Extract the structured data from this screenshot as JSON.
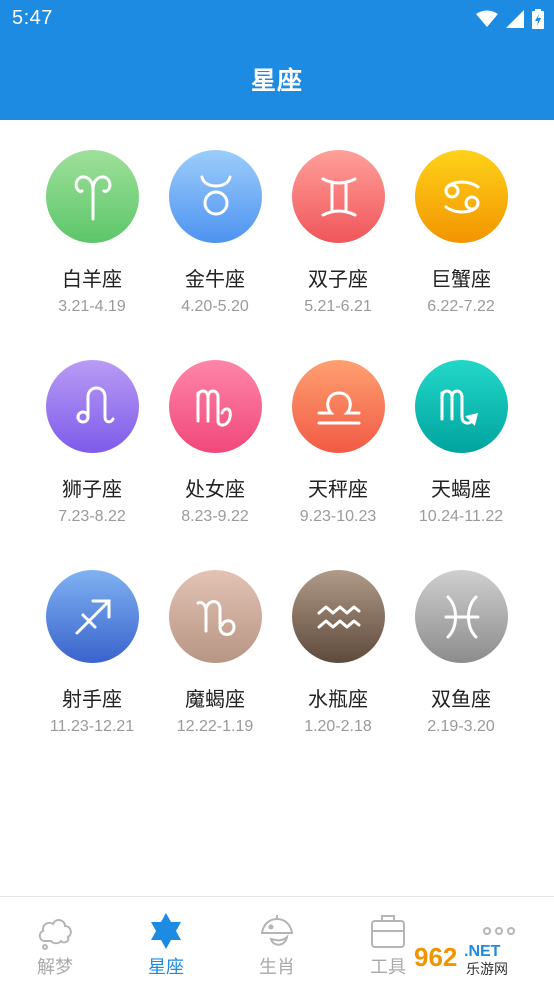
{
  "status_bar": {
    "time": "5:47"
  },
  "header": {
    "title": "星座"
  },
  "zodiacs": [
    {
      "name": "白羊座",
      "date": "3.21-4.19",
      "icon": "aries-icon",
      "colors": [
        "#9fe09a",
        "#5cc66a"
      ]
    },
    {
      "name": "金牛座",
      "date": "4.20-5.20",
      "icon": "taurus-icon",
      "colors": [
        "#9ccdfb",
        "#4e93f0"
      ]
    },
    {
      "name": "双子座",
      "date": "5.21-6.21",
      "icon": "gemini-icon",
      "colors": [
        "#ffa09a",
        "#f0555a"
      ]
    },
    {
      "name": "巨蟹座",
      "date": "6.22-7.22",
      "icon": "cancer-icon",
      "colors": [
        "#ffd21a",
        "#f29400"
      ]
    },
    {
      "name": "狮子座",
      "date": "7.23-8.22",
      "icon": "leo-icon",
      "colors": [
        "#b99cf5",
        "#7e5bea"
      ]
    },
    {
      "name": "处女座",
      "date": "8.23-9.22",
      "icon": "virgo-icon",
      "colors": [
        "#ff86a8",
        "#f0487a"
      ]
    },
    {
      "name": "天秤座",
      "date": "9.23-10.23",
      "icon": "libra-icon",
      "colors": [
        "#ffa070",
        "#f25a45"
      ]
    },
    {
      "name": "天蝎座",
      "date": "10.24-11.22",
      "icon": "scorpio-icon",
      "colors": [
        "#22d8c8",
        "#00a39e"
      ]
    },
    {
      "name": "射手座",
      "date": "11.23-12.21",
      "icon": "sagittarius-icon",
      "colors": [
        "#7fb2f2",
        "#3a63cc"
      ]
    },
    {
      "name": "魔蝎座",
      "date": "12.22-1.19",
      "icon": "capricorn-icon",
      "colors": [
        "#e2c3b4",
        "#b89584"
      ]
    },
    {
      "name": "水瓶座",
      "date": "1.20-2.18",
      "icon": "aquarius-icon",
      "colors": [
        "#b09a88",
        "#5e4a3c"
      ]
    },
    {
      "name": "双鱼座",
      "date": "2.19-3.20",
      "icon": "pisces-icon",
      "colors": [
        "#cfcfcf",
        "#8c8c8c"
      ]
    }
  ],
  "tabs": [
    {
      "label": "解梦",
      "icon": "cloud-icon",
      "active": false
    },
    {
      "label": "星座",
      "icon": "star-icon",
      "active": true
    },
    {
      "label": "生肖",
      "icon": "zodiac-animal-icon",
      "active": false
    },
    {
      "label": "工具",
      "icon": "toolbox-icon",
      "active": false
    },
    {
      "label": "",
      "icon": "more-icon",
      "active": false
    }
  ],
  "theme": {
    "primary": "#1e8be3",
    "inactive": "#aaaaaa"
  },
  "watermark": {
    "text": "962.NET",
    "subtext": "乐游网"
  }
}
